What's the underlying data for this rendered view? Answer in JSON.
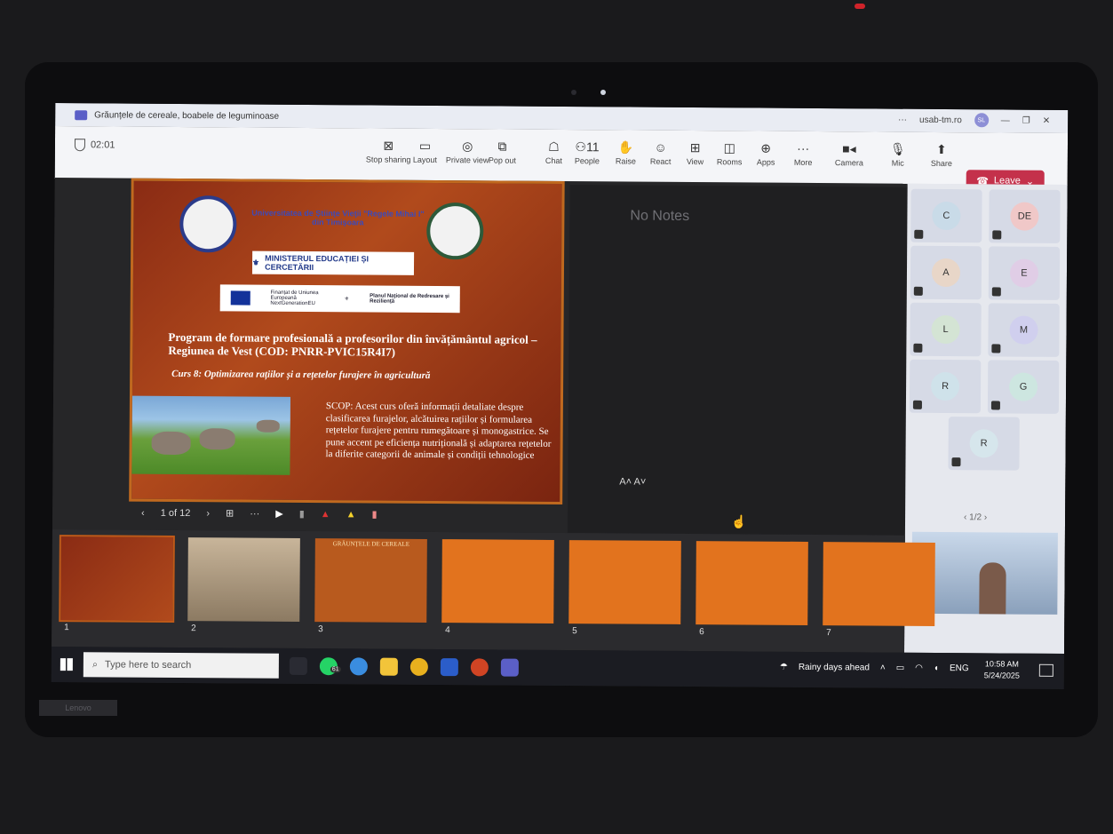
{
  "window": {
    "title": "Grăunțele de cereale, boabele de leguminoase"
  },
  "meeting": {
    "timer": "02:01",
    "account": "usab-tm.ro",
    "avatar": "SL",
    "toolbar": [
      {
        "label": "Stop sharing",
        "icon": "stop-share-icon",
        "glyph": "⊠"
      },
      {
        "label": "Layout",
        "icon": "layout-icon",
        "glyph": "▭"
      },
      {
        "label": "Private view",
        "icon": "eye-icon",
        "glyph": "◎"
      },
      {
        "label": "Pop out",
        "icon": "pop-out-icon",
        "glyph": "⧉"
      },
      {
        "label": "Chat",
        "icon": "chat-icon",
        "glyph": "☖"
      },
      {
        "label": "People",
        "icon": "people-icon",
        "glyph": "⚇11"
      },
      {
        "label": "Raise",
        "icon": "hand-icon",
        "glyph": "✋"
      },
      {
        "label": "React",
        "icon": "smile-icon",
        "glyph": "☺"
      },
      {
        "label": "View",
        "icon": "grid-icon",
        "glyph": "⊞"
      },
      {
        "label": "Rooms",
        "icon": "rooms-icon",
        "glyph": "◫"
      },
      {
        "label": "Apps",
        "icon": "plus-icon",
        "glyph": "⊕"
      },
      {
        "label": "More",
        "icon": "more-icon",
        "glyph": "···"
      },
      {
        "label": "Camera",
        "icon": "camera-icon",
        "glyph": "■◂"
      },
      {
        "label": "Mic",
        "icon": "mic-off-icon",
        "glyph": "🎙"
      },
      {
        "label": "Share",
        "icon": "share-icon",
        "glyph": "⬆"
      }
    ],
    "leave_label": "Leave"
  },
  "slide": {
    "university": "Universitatea de Ştiinţe Vieţii \"Regele Mihai I\" din Timişoara",
    "ministry": "MINISTERUL EDUCAȚIEI ȘI CERCETĂRII",
    "eu_left": "Finanțat de Uniunea Europeană NextGenerationEU",
    "eu_right": "Planul Național de Redresare și Reziliență",
    "title": "Program de formare profesională a profesorilor din învățământul agricol – Regiunea de Vest (COD: PNRR-PVIC15R4I7)",
    "course": "Curs 8: Optimizarea rațiilor și a rețetelor furajere în agricultură",
    "scope": "SCOP: Acest curs oferă informații detaliate despre clasificarea furajelor, alcătuirea rațiilor și formularea rețetelor furajere pentru rumegătoare și monogastrice. Se pune accent pe eficiența nutrițională și adaptarea rețetelor la diferite categorii de animale și condiții tehnologice",
    "position": "1 of 12"
  },
  "notes": {
    "empty": "No Notes",
    "font_controls": "A˄  A˅"
  },
  "participants": {
    "tiles": [
      {
        "initials": "C",
        "color": "#c9dbe8"
      },
      {
        "initials": "DE",
        "color": "#f0c8c8"
      },
      {
        "initials": "A",
        "color": "#e8d6c8"
      },
      {
        "initials": "E",
        "color": "#e0cde6"
      },
      {
        "initials": "L",
        "color": "#d4e4d4"
      },
      {
        "initials": "M",
        "color": "#d0cfee"
      },
      {
        "initials": "R",
        "color": "#cfe2ea"
      },
      {
        "initials": "G",
        "color": "#cde6e0"
      },
      {
        "initials": "R",
        "color": "#d6e6ec"
      }
    ],
    "pager": "1/2"
  },
  "thumbnails": [
    "1",
    "2",
    "3",
    "4",
    "5",
    "6",
    "7"
  ],
  "thumb3_title": "GRĂUNȚELE DE CEREALE",
  "taskbar": {
    "search_placeholder": "Type here to search",
    "weather": "Rainy days ahead",
    "lang": "ENG",
    "time": "10:58 AM",
    "date": "5/24/2025",
    "whatsapp_badge": "61"
  },
  "brand": "Lenovo"
}
